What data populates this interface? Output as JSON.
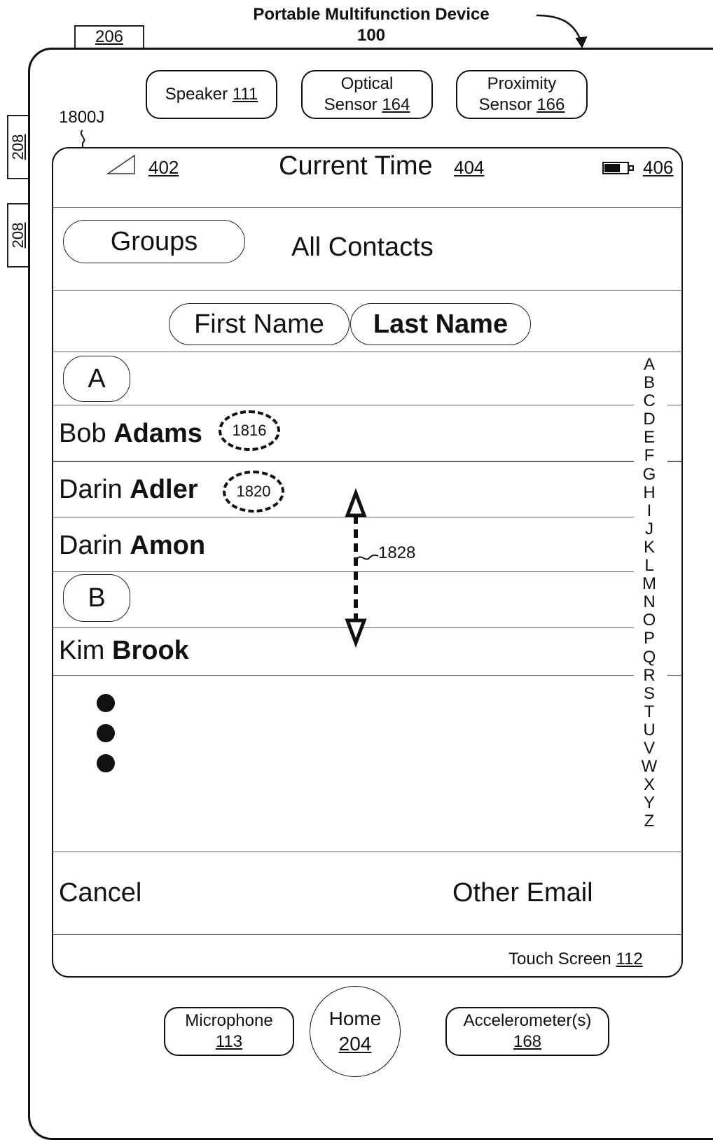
{
  "header": {
    "title_line1": "Portable Multifunction Device",
    "title_line2": "100",
    "ref_206": "206",
    "side_button_1": "208",
    "side_button_2": "208",
    "screen_ref": "1800J"
  },
  "hardware_top": {
    "speaker": {
      "label": "Speaker",
      "ref": "111"
    },
    "optical": {
      "line1": "Optical",
      "label": "Sensor",
      "ref": "164"
    },
    "proximity": {
      "line1": "Proximity",
      "label": "Sensor",
      "ref": "166"
    }
  },
  "status_bar": {
    "signal_ref": "402",
    "time_label": "Current Time",
    "time_ref": "404",
    "battery_ref": "406"
  },
  "nav": {
    "groups_button": "Groups",
    "title": "All Contacts"
  },
  "sort": {
    "first_name": "First Name",
    "last_name": "Last Name"
  },
  "sections": [
    {
      "header": "A",
      "contacts": [
        {
          "first": "Bob",
          "last": "Adams",
          "ref": "1816"
        },
        {
          "first": "Darin",
          "last": "Adler",
          "ref": "1820"
        },
        {
          "first": "Darin",
          "last": "Amon"
        }
      ]
    },
    {
      "header": "B",
      "contacts": [
        {
          "first": "Kim",
          "last": "Brook"
        }
      ]
    }
  ],
  "scroll_gesture_ref": "1828",
  "index_letters": [
    "A",
    "B",
    "C",
    "D",
    "E",
    "F",
    "G",
    "H",
    "I",
    "J",
    "K",
    "L",
    "M",
    "N",
    "O",
    "P",
    "Q",
    "R",
    "S",
    "T",
    "U",
    "V",
    "W",
    "X",
    "Y",
    "Z"
  ],
  "bottom_bar": {
    "cancel": "Cancel",
    "other_email": "Other Email"
  },
  "touch_screen": {
    "label": "Touch Screen",
    "ref": "112"
  },
  "hardware_bottom": {
    "microphone": {
      "label": "Microphone",
      "ref": "113"
    },
    "home": {
      "label": "Home",
      "ref": "204"
    },
    "accelerometer": {
      "label": "Accelerometer(s)",
      "ref": "168"
    }
  }
}
